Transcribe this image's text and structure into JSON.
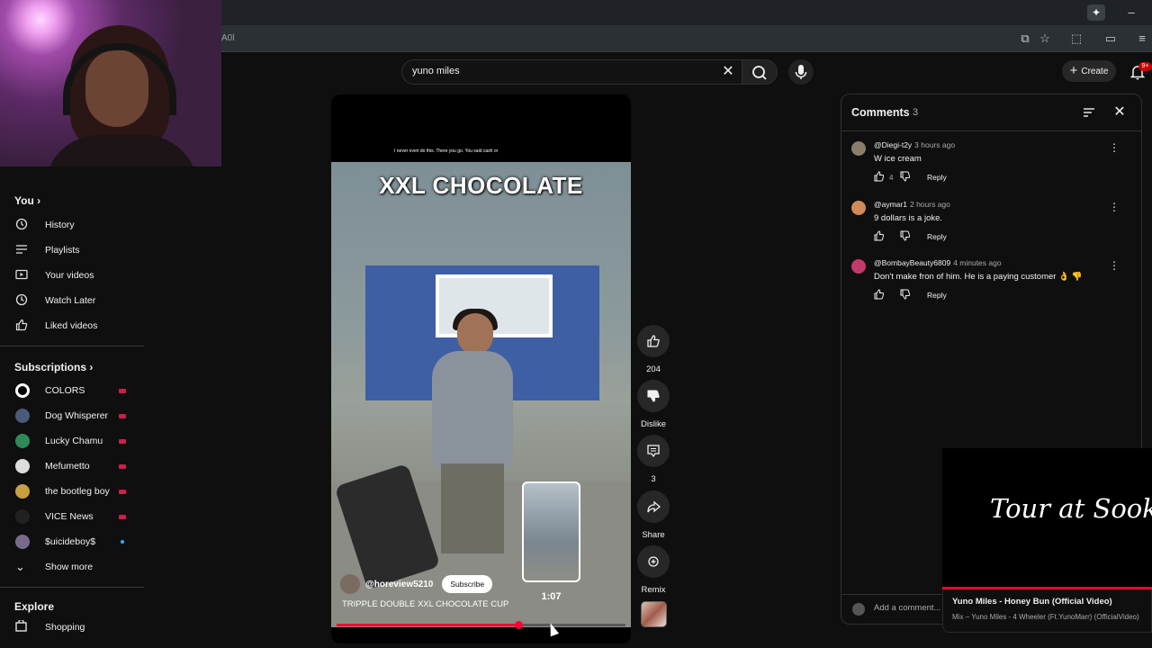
{
  "browser": {
    "address_fragment": "A0l"
  },
  "search": {
    "query": "yuno miles"
  },
  "header": {
    "create_label": "Create",
    "notif_badge": "9+"
  },
  "sidebar": {
    "you_label": "You",
    "you_items": [
      {
        "icon": "history-icon",
        "label": "History"
      },
      {
        "icon": "playlists-icon",
        "label": "Playlists"
      },
      {
        "icon": "your-videos-icon",
        "label": "Your videos"
      },
      {
        "icon": "watch-later-icon",
        "label": "Watch Later"
      },
      {
        "icon": "liked-icon",
        "label": "Liked videos"
      }
    ],
    "subscriptions_label": "Subscriptions",
    "subscriptions": [
      {
        "label": "COLORS",
        "live": true
      },
      {
        "label": "Dog Whisperer",
        "live": true
      },
      {
        "label": "Lucky Chamu",
        "live": true
      },
      {
        "label": "Mefumetto",
        "live": true
      },
      {
        "label": "the bootleg boy",
        "live": true
      },
      {
        "label": "VICE News",
        "live": true
      },
      {
        "label": "$uicideboy$",
        "live": false
      }
    ],
    "show_more_label": "Show more",
    "explore_label": "Explore",
    "explore_items": [
      {
        "icon": "shopping-icon",
        "label": "Shopping"
      }
    ]
  },
  "short": {
    "overlay_caption": "I never even do this. There you go. You said cash or",
    "overlay_title": "XXL CHOCOLATE",
    "channel": "@horeview5210",
    "subscribe_label": "Subscribe",
    "title": "TRIPPLE DOUBLE XXL CHOCOLATE CUP",
    "preview_time": "1:07",
    "progress_fraction": 0.63,
    "hover_fraction": 0.74
  },
  "actions": {
    "like_count": "204",
    "dislike_label": "Dislike",
    "comments_count": "3",
    "share_label": "Share",
    "remix_label": "Remix"
  },
  "comments": {
    "title": "Comments",
    "count": "3",
    "items": [
      {
        "author": "@Diegi-t2y",
        "time": "3 hours ago",
        "text": "W ice cream",
        "likes": "4",
        "reply": "Reply",
        "avatar_color": "#8a7d6a"
      },
      {
        "author": "@aymar1",
        "time": "2 hours ago",
        "text": "9 dollars is a joke.",
        "likes": "",
        "reply": "Reply",
        "avatar_color": "#d08a5a"
      },
      {
        "author": "@BombayBeauty6809",
        "time": "4 minutes ago",
        "text": "Don't make fron of him. He is a paying customer 👌 👎",
        "likes": "",
        "reply": "Reply",
        "avatar_color": "#c23a6a"
      }
    ],
    "add_placeholder": "Add a comment..."
  },
  "mini_player": {
    "video_text": "Tour at Sook",
    "title": "Yuno Miles - Honey Bun (Official Video)",
    "subtitle": "Mix – Yuno Miles - 4 Wheeler (Ft.YunoMarr) (OfficialVideo)"
  },
  "colors": {
    "accent_red": "#ff0033",
    "live_badge": "#cc1f4a",
    "background": "#0f0f0f"
  }
}
